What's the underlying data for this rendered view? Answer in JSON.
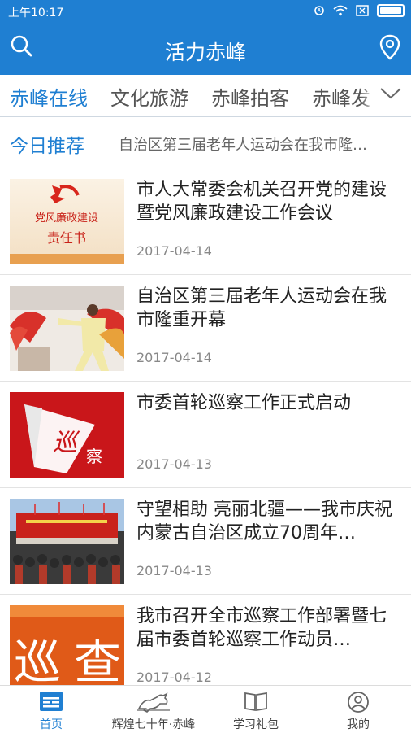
{
  "status_bar": {
    "time": "上午10:17"
  },
  "header": {
    "title": "活力赤峰"
  },
  "tabs": [
    {
      "label": "赤峰在线"
    },
    {
      "label": "文化旅游"
    },
    {
      "label": "赤峰拍客"
    },
    {
      "label": "赤峰发"
    }
  ],
  "recommend": {
    "label": "今日推荐",
    "headline": "自治区第三届老年人运动会在我市隆…"
  },
  "articles": [
    {
      "title": "市人大常委会机关召开党的建设暨党风廉政建设工作会议",
      "date": "2017-04-14",
      "thumb_text": [
        "党风廉政建设",
        "责任书"
      ]
    },
    {
      "title": "自治区第三届老年人运动会在我市隆重开幕",
      "date": "2017-04-14"
    },
    {
      "title": "市委首轮巡察工作正式启动",
      "date": "2017-04-13",
      "thumb_text": [
        "巡",
        "察"
      ]
    },
    {
      "title": "守望相助 亮丽北疆——我市庆祝内蒙古自治区成立70周年…",
      "date": "2017-04-13"
    },
    {
      "title": "我市召开全市巡察工作部署暨七届市委首轮巡察工作动员…",
      "date": "2017-04-12",
      "thumb_text": [
        "巡",
        "查"
      ]
    }
  ],
  "bottom_nav": [
    {
      "label": "首页",
      "icon": "home-icon"
    },
    {
      "label": "辉煌七十年·赤峰",
      "icon": "horse-icon"
    },
    {
      "label": "学习礼包",
      "icon": "book-icon"
    },
    {
      "label": "我的",
      "icon": "profile-icon"
    }
  ],
  "colors": {
    "accent": "#1f7fd2"
  }
}
